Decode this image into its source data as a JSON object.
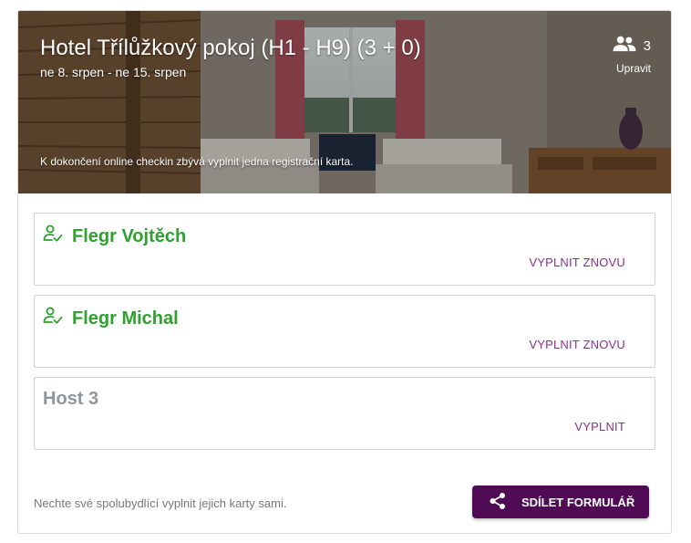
{
  "booking": {
    "title": "Hotel Třílůžkový pokoj (H1 - H9) (3 + 0)",
    "dates": "ne 8. srpen - ne 15. srpen",
    "note": "K dokončení online checkin zbývá vyplnit jedna registrační karta.",
    "guest_count": "3",
    "edit_label": "Upravit",
    "icons": {
      "guests": "people-icon"
    }
  },
  "guests": [
    {
      "name": "Flegr Vojtěch",
      "action": "VYPLNIT ZNOVU",
      "status": "done",
      "icon": "person-check-icon"
    },
    {
      "name": "Flegr Michal",
      "action": "VYPLNIT ZNOVU",
      "status": "done",
      "icon": "person-check-icon"
    },
    {
      "name": "Host 3",
      "action": "VYPLNIT",
      "status": "pending"
    }
  ],
  "footer": {
    "text": "Nechte své spolubydlící vyplnit jejich karty sami.",
    "share_label": "SDÍLET FORMULÁŘ",
    "share_icon": "share-icon"
  },
  "colors": {
    "done": "#2ea12e",
    "pending": "#8e979d",
    "action": "#8e2e8e",
    "share_button": "#4f0b54"
  }
}
